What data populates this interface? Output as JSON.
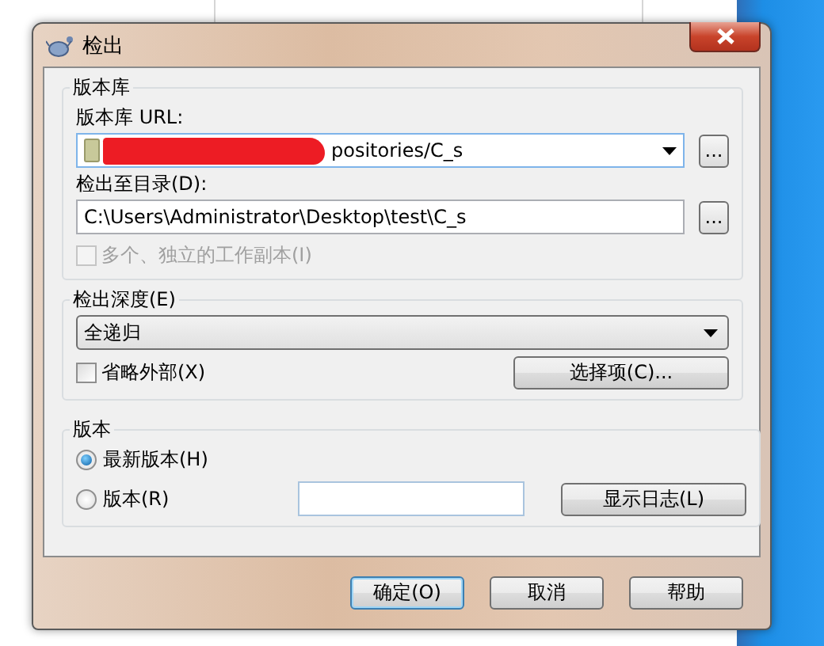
{
  "window": {
    "title": "检出"
  },
  "repository": {
    "title": "版本库",
    "url_label": "版本库 URL:",
    "url": "positories/C_s",
    "url_browse": "...",
    "dir_label": "检出至目录(D):",
    "dir": "C:\\Users\\Administrator\\Desktop\\test\\C_s",
    "dir_browse": "...",
    "multiple": {
      "label": "多个、独立的工作副本(I)",
      "checked": false,
      "disabled": true
    }
  },
  "depth": {
    "title": "检出深度(E)",
    "value": "全递归",
    "omit_externals": {
      "label": "省略外部(X)",
      "checked": false,
      "disabled": false
    },
    "options_button": "选择项(C)..."
  },
  "revision": {
    "title": "版本",
    "options": [
      {
        "label": "最新版本(H)",
        "selected": true
      },
      {
        "label": "版本(R)",
        "selected": false
      }
    ],
    "show_log_button": "显示日志(L)"
  },
  "buttons": [
    {
      "label": "确定(O)",
      "default": true
    },
    {
      "label": "取消",
      "default": false
    },
    {
      "label": "帮助",
      "default": false
    }
  ]
}
